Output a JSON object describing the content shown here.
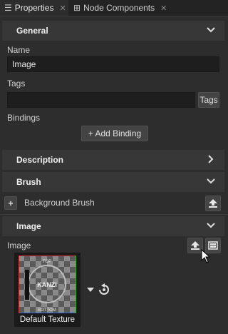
{
  "tabs": [
    {
      "label": "Properties",
      "icon": "list-icon",
      "active": true
    },
    {
      "label": "Node Components",
      "icon": "grid-icon",
      "active": false
    }
  ],
  "general": {
    "title": "General",
    "name_label": "Name",
    "name_value": "Image",
    "tags_label": "Tags",
    "tags_value": "",
    "tags_button": "Tags",
    "bindings_label": "Bindings",
    "add_binding": "+ Add Binding"
  },
  "description": {
    "title": "Description"
  },
  "brush": {
    "title": "Brush",
    "background_brush_label": "Background Brush",
    "add_symbol": "+"
  },
  "image": {
    "title": "Image",
    "image_label": "Image",
    "texture_name": "Default Texture",
    "thumb_top": "TOP",
    "thumb_bottom": "BOTTOM",
    "thumb_center": "KANZI"
  },
  "colors": {
    "background": "#2d2d2d",
    "section": "#373737",
    "field": "#1e1e1e"
  }
}
